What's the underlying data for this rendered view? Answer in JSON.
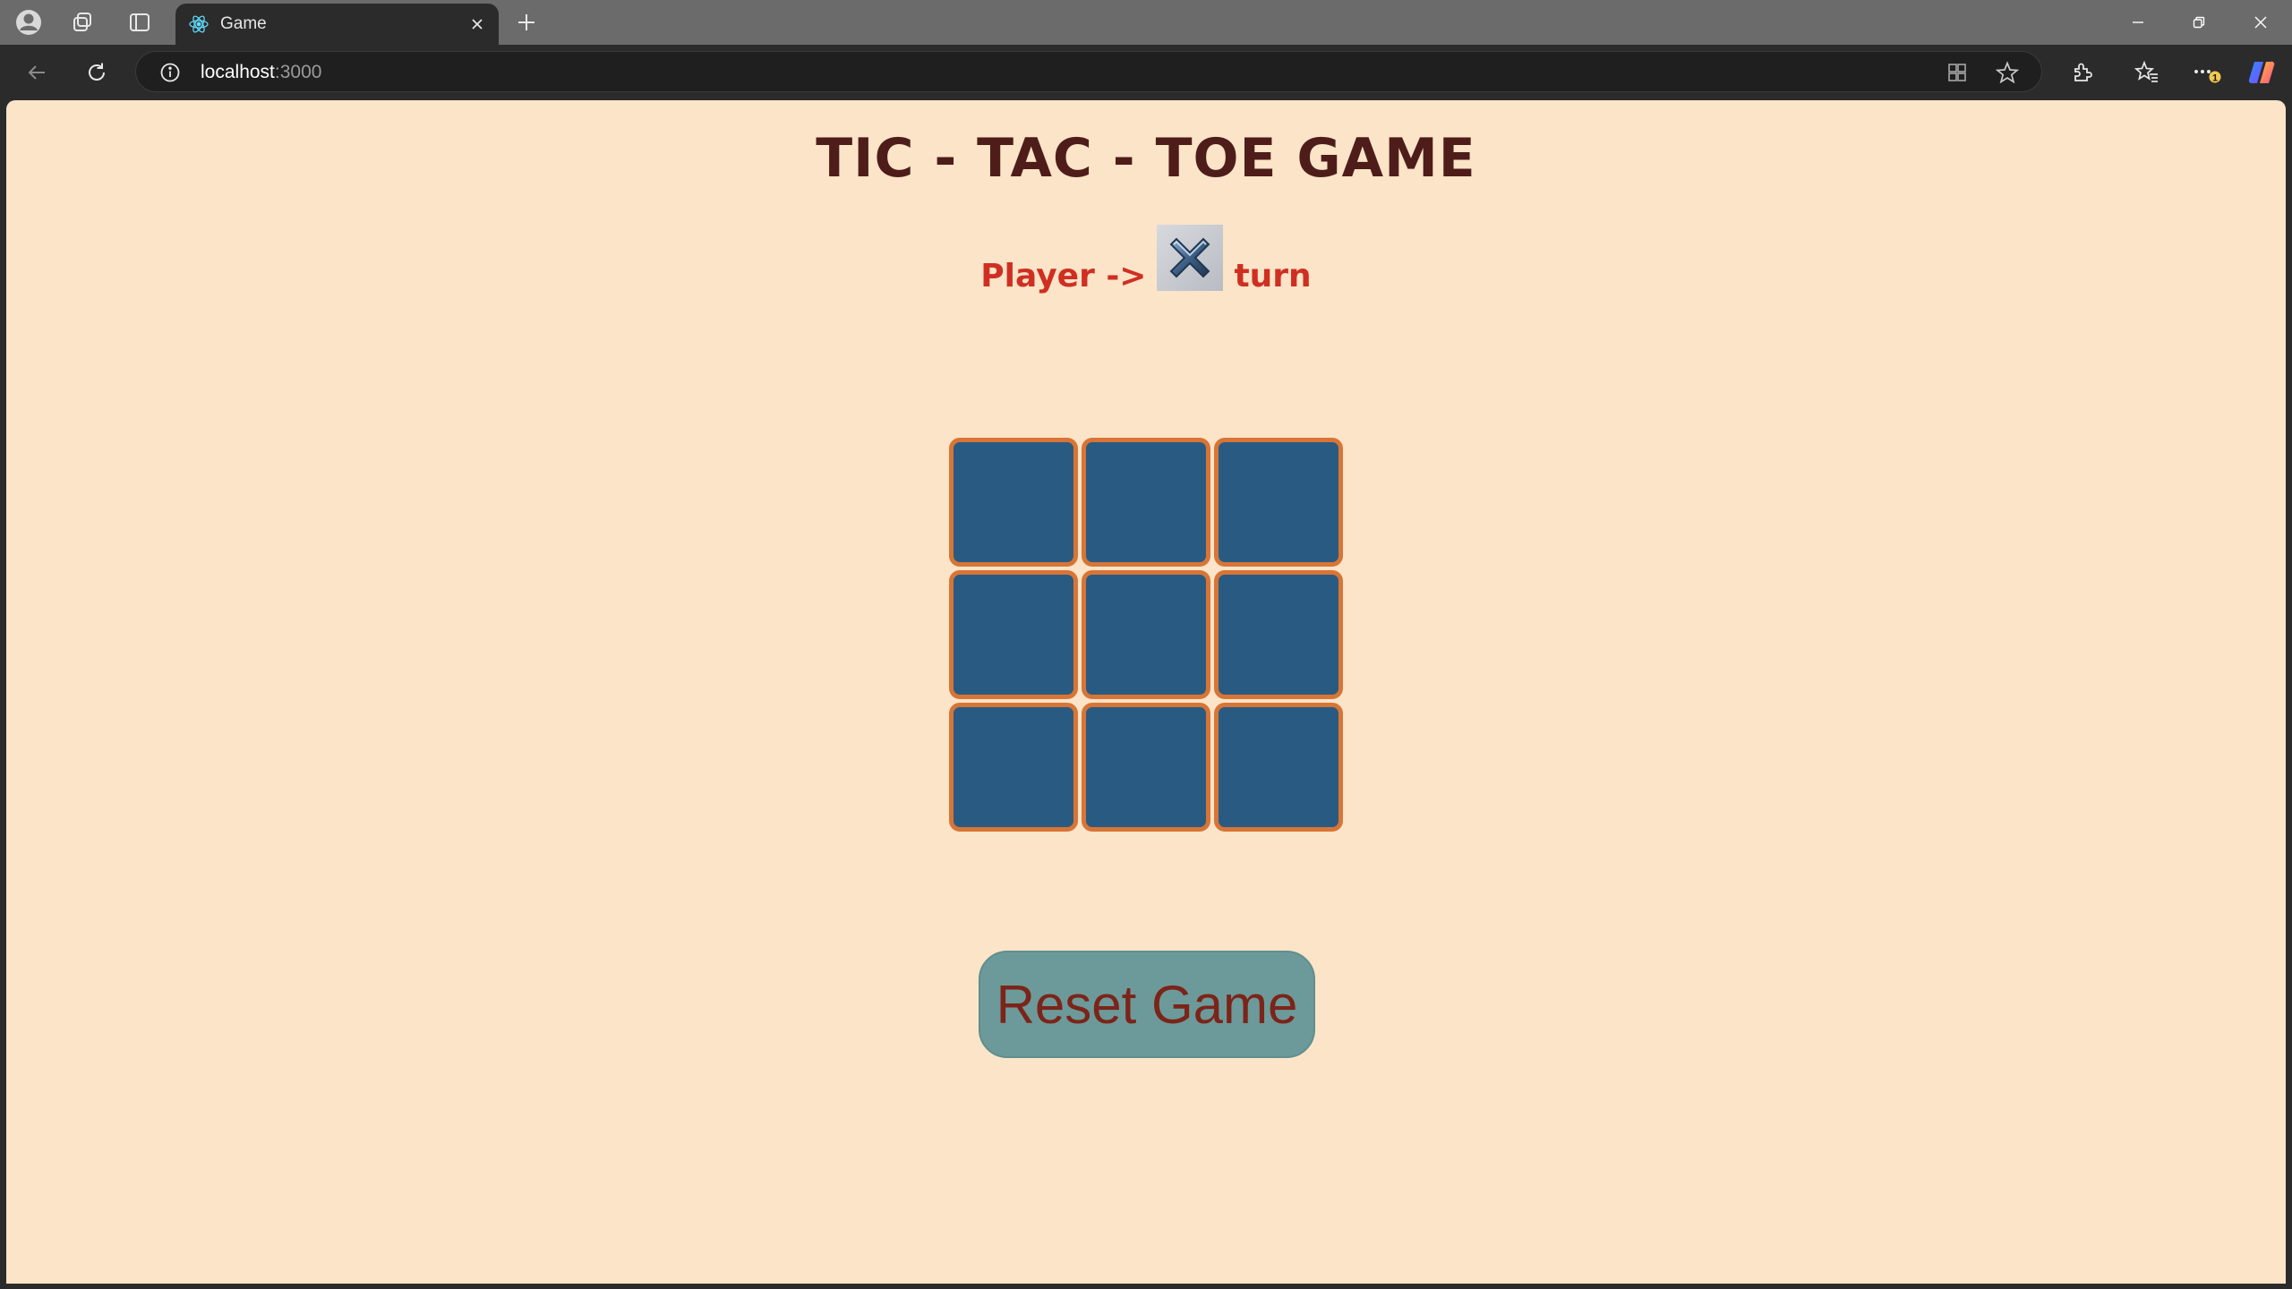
{
  "browser": {
    "tab_title": "Game",
    "url_host": "localhost",
    "url_port": ":3000",
    "icons": {
      "profile": "profile-icon",
      "workspaces": "workspaces-icon",
      "vertical_tabs": "vertical-tabs-icon",
      "favicon": "react-icon",
      "close_tab": "close-icon",
      "new_tab": "plus-icon",
      "back": "back-arrow-icon",
      "refresh": "refresh-icon",
      "info": "info-icon",
      "app_view": "apps-icon",
      "favorite": "star-icon",
      "extensions": "extensions-icon",
      "favorites": "favorites-icon",
      "more": "more-icon",
      "copilot": "copilot-icon"
    },
    "notification_badge": "1"
  },
  "game": {
    "title": "TIC - TAC - TOE GAME",
    "turn_prefix": "Player ->",
    "turn_suffix": "turn",
    "current_player": "X",
    "board": [
      "",
      "",
      "",
      "",
      "",
      "",
      "",
      "",
      ""
    ],
    "reset_label": "Reset Game"
  },
  "colors": {
    "page_background": "#fbe4c8",
    "title": "#4e1d1a",
    "turn_text": "#cf2f22",
    "cell_fill": "#295b82",
    "cell_border": "#d87536",
    "reset_bg": "#6c9a9a",
    "reset_text": "#7c2419"
  }
}
